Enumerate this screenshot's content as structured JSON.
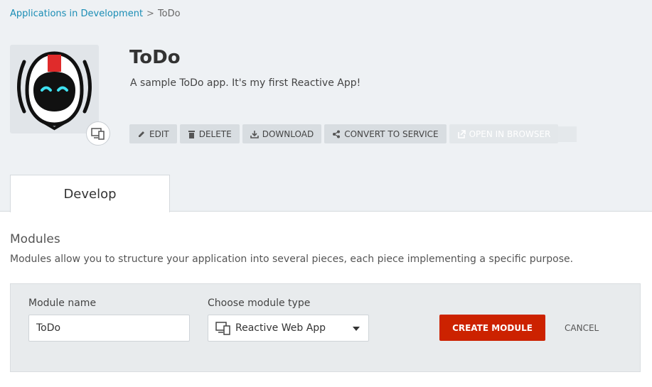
{
  "breadcrumb": {
    "parent": "Applications in Development",
    "separator": ">",
    "current": "ToDo"
  },
  "app": {
    "title": "ToDo",
    "description": "A sample ToDo app. It's my first Reactive App!",
    "icon": "astronaut-robot-icon",
    "type_icon": "devices-icon"
  },
  "actions": {
    "edit": "EDIT",
    "delete": "DELETE",
    "download": "DOWNLOAD",
    "convert": "CONVERT TO SERVICE",
    "open_browser": "OPEN IN BROWSER"
  },
  "tabs": [
    {
      "label": "Develop",
      "active": true
    }
  ],
  "modules": {
    "title": "Modules",
    "description": "Modules allow you to structure your application into several pieces, each piece implementing a specific purpose.",
    "form": {
      "name_label": "Module name",
      "name_value": "ToDo",
      "type_label": "Choose module type",
      "type_value": "Reactive Web App",
      "create_label": "CREATE MODULE",
      "cancel_label": "CANCEL"
    }
  },
  "colors": {
    "accent_link": "#1a8db5",
    "primary_button": "#cc2200",
    "header_bg": "#eef1f4"
  }
}
